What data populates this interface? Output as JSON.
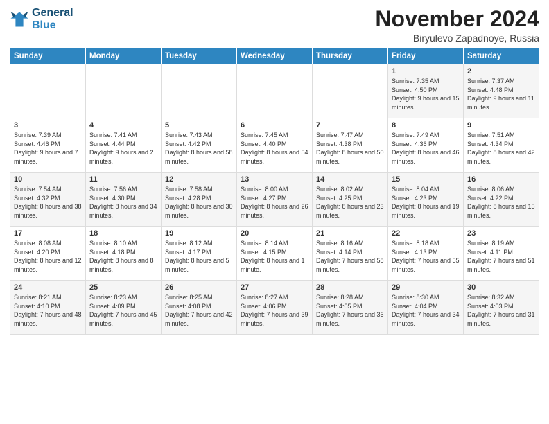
{
  "logo": {
    "line1": "General",
    "line2": "Blue"
  },
  "title": "November 2024",
  "subtitle": "Biryulevo Zapadnoye, Russia",
  "days_header": [
    "Sunday",
    "Monday",
    "Tuesday",
    "Wednesday",
    "Thursday",
    "Friday",
    "Saturday"
  ],
  "weeks": [
    [
      {
        "num": "",
        "info": ""
      },
      {
        "num": "",
        "info": ""
      },
      {
        "num": "",
        "info": ""
      },
      {
        "num": "",
        "info": ""
      },
      {
        "num": "",
        "info": ""
      },
      {
        "num": "1",
        "info": "Sunrise: 7:35 AM\nSunset: 4:50 PM\nDaylight: 9 hours and 15 minutes."
      },
      {
        "num": "2",
        "info": "Sunrise: 7:37 AM\nSunset: 4:48 PM\nDaylight: 9 hours and 11 minutes."
      }
    ],
    [
      {
        "num": "3",
        "info": "Sunrise: 7:39 AM\nSunset: 4:46 PM\nDaylight: 9 hours and 7 minutes."
      },
      {
        "num": "4",
        "info": "Sunrise: 7:41 AM\nSunset: 4:44 PM\nDaylight: 9 hours and 2 minutes."
      },
      {
        "num": "5",
        "info": "Sunrise: 7:43 AM\nSunset: 4:42 PM\nDaylight: 8 hours and 58 minutes."
      },
      {
        "num": "6",
        "info": "Sunrise: 7:45 AM\nSunset: 4:40 PM\nDaylight: 8 hours and 54 minutes."
      },
      {
        "num": "7",
        "info": "Sunrise: 7:47 AM\nSunset: 4:38 PM\nDaylight: 8 hours and 50 minutes."
      },
      {
        "num": "8",
        "info": "Sunrise: 7:49 AM\nSunset: 4:36 PM\nDaylight: 8 hours and 46 minutes."
      },
      {
        "num": "9",
        "info": "Sunrise: 7:51 AM\nSunset: 4:34 PM\nDaylight: 8 hours and 42 minutes."
      }
    ],
    [
      {
        "num": "10",
        "info": "Sunrise: 7:54 AM\nSunset: 4:32 PM\nDaylight: 8 hours and 38 minutes."
      },
      {
        "num": "11",
        "info": "Sunrise: 7:56 AM\nSunset: 4:30 PM\nDaylight: 8 hours and 34 minutes."
      },
      {
        "num": "12",
        "info": "Sunrise: 7:58 AM\nSunset: 4:28 PM\nDaylight: 8 hours and 30 minutes."
      },
      {
        "num": "13",
        "info": "Sunrise: 8:00 AM\nSunset: 4:27 PM\nDaylight: 8 hours and 26 minutes."
      },
      {
        "num": "14",
        "info": "Sunrise: 8:02 AM\nSunset: 4:25 PM\nDaylight: 8 hours and 23 minutes."
      },
      {
        "num": "15",
        "info": "Sunrise: 8:04 AM\nSunset: 4:23 PM\nDaylight: 8 hours and 19 minutes."
      },
      {
        "num": "16",
        "info": "Sunrise: 8:06 AM\nSunset: 4:22 PM\nDaylight: 8 hours and 15 minutes."
      }
    ],
    [
      {
        "num": "17",
        "info": "Sunrise: 8:08 AM\nSunset: 4:20 PM\nDaylight: 8 hours and 12 minutes."
      },
      {
        "num": "18",
        "info": "Sunrise: 8:10 AM\nSunset: 4:18 PM\nDaylight: 8 hours and 8 minutes."
      },
      {
        "num": "19",
        "info": "Sunrise: 8:12 AM\nSunset: 4:17 PM\nDaylight: 8 hours and 5 minutes."
      },
      {
        "num": "20",
        "info": "Sunrise: 8:14 AM\nSunset: 4:15 PM\nDaylight: 8 hours and 1 minute."
      },
      {
        "num": "21",
        "info": "Sunrise: 8:16 AM\nSunset: 4:14 PM\nDaylight: 7 hours and 58 minutes."
      },
      {
        "num": "22",
        "info": "Sunrise: 8:18 AM\nSunset: 4:13 PM\nDaylight: 7 hours and 55 minutes."
      },
      {
        "num": "23",
        "info": "Sunrise: 8:19 AM\nSunset: 4:11 PM\nDaylight: 7 hours and 51 minutes."
      }
    ],
    [
      {
        "num": "24",
        "info": "Sunrise: 8:21 AM\nSunset: 4:10 PM\nDaylight: 7 hours and 48 minutes."
      },
      {
        "num": "25",
        "info": "Sunrise: 8:23 AM\nSunset: 4:09 PM\nDaylight: 7 hours and 45 minutes."
      },
      {
        "num": "26",
        "info": "Sunrise: 8:25 AM\nSunset: 4:08 PM\nDaylight: 7 hours and 42 minutes."
      },
      {
        "num": "27",
        "info": "Sunrise: 8:27 AM\nSunset: 4:06 PM\nDaylight: 7 hours and 39 minutes."
      },
      {
        "num": "28",
        "info": "Sunrise: 8:28 AM\nSunset: 4:05 PM\nDaylight: 7 hours and 36 minutes."
      },
      {
        "num": "29",
        "info": "Sunrise: 8:30 AM\nSunset: 4:04 PM\nDaylight: 7 hours and 34 minutes."
      },
      {
        "num": "30",
        "info": "Sunrise: 8:32 AM\nSunset: 4:03 PM\nDaylight: 7 hours and 31 minutes."
      }
    ]
  ]
}
